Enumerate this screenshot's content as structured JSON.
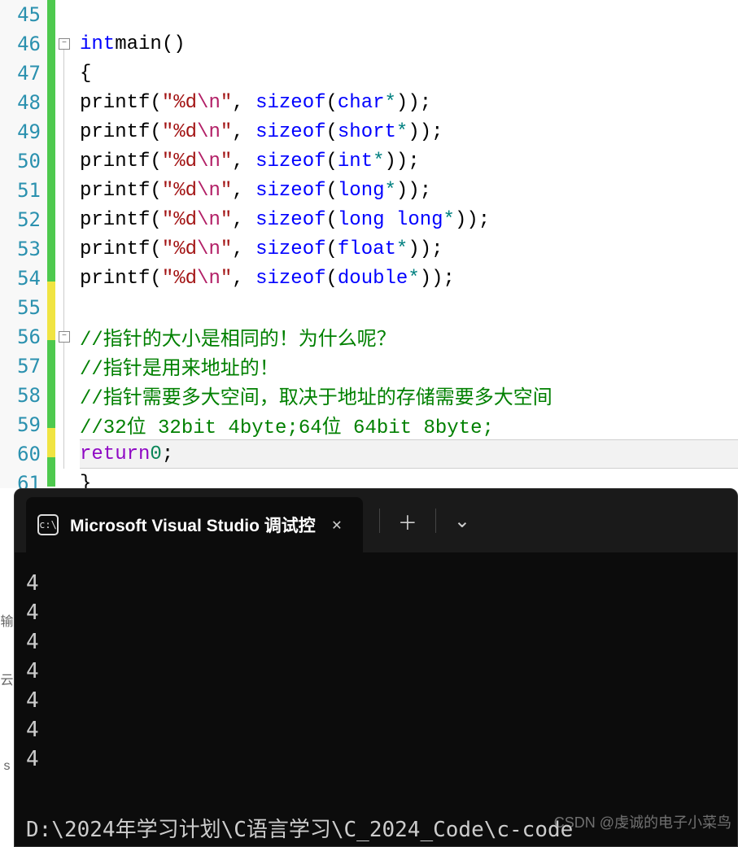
{
  "editor": {
    "line_numbers": [
      "45",
      "46",
      "47",
      "48",
      "49",
      "50",
      "51",
      "52",
      "53",
      "54",
      "55",
      "56",
      "57",
      "58",
      "59",
      "60",
      "61"
    ],
    "code": {
      "l46": {
        "kw": "int",
        "fn": "main"
      },
      "printf_label": "printf",
      "sizeof_label": "sizeof",
      "fmt_open": "\"",
      "fmt_d": "%d",
      "fmt_esc": "\\n",
      "fmt_close": "\"",
      "types": [
        "char",
        "short",
        "int",
        "long",
        "long long",
        "float",
        "double"
      ],
      "comments": {
        "c1": "//指针的大小是相同的！为什么呢？",
        "c2": "//指针是用来地址的！",
        "c3": "//指针需要多大空间，取决于地址的存储需要多大空间",
        "c4": "//32位 32bit 4byte;64位 64bit 8byte;"
      },
      "return_kw": "return",
      "return_val": "0"
    }
  },
  "terminal": {
    "tab_title": "Microsoft Visual Studio 调试控",
    "output_lines": [
      "4",
      "4",
      "4",
      "4",
      "4",
      "4",
      "4"
    ],
    "path": "D:\\2024年学习计划\\C语言学习\\C_2024_Code\\c-code"
  },
  "watermark": "CSDN @虔诚的电子小菜鸟",
  "left_fragments": [
    "",
    "",
    "",
    "",
    "输",
    "",
    "云",
    "",
    "",
    "s",
    ""
  ]
}
